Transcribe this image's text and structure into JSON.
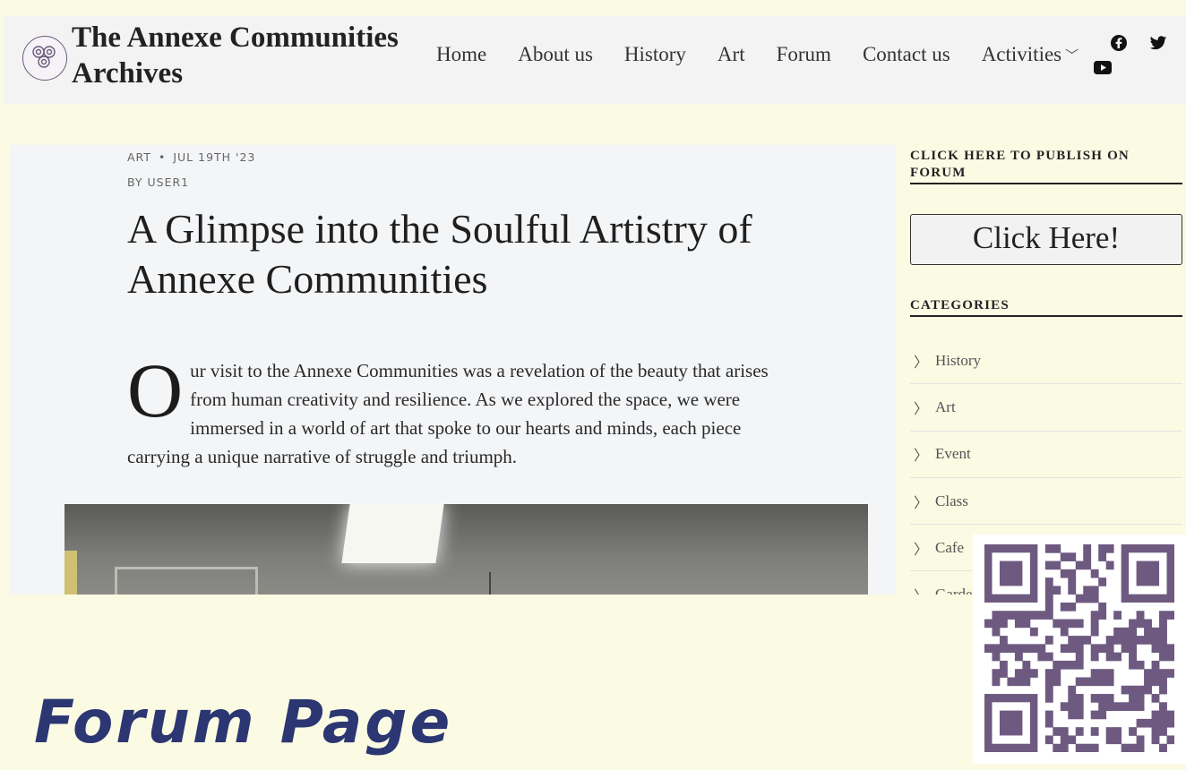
{
  "header": {
    "site_title": "The Annexe Communities Archives",
    "logo_icon": "triskele-spiral-logo",
    "nav": [
      "Home",
      "About us",
      "History",
      "Art",
      "Forum",
      "Contact us",
      "Activities"
    ],
    "social": [
      "facebook-icon",
      "twitter-icon",
      "youtube-icon"
    ]
  },
  "article": {
    "category": "ART",
    "date": "JUL 19TH '23",
    "author": "BY USER1",
    "title": "A Glimpse into the Soulful Artistry of Annexe Communities",
    "drop_cap": "O",
    "body": "ur visit to the Annexe Communities was a revelation of the beauty that arises from human creativity and resilience. As we explored the space, we were immersed in a world of art that spoke to our hearts and minds, each piece carrying a unique narrative of struggle and triumph."
  },
  "sidebar": {
    "publish_heading": "CLICK HERE TO PUBLISH ON FORUM",
    "publish_button": "Click Here!",
    "categories_heading": "CATEGORIES",
    "categories": [
      "History",
      "Art",
      "Event",
      "Class",
      "Cafe",
      "Garden"
    ]
  },
  "bottom": {
    "title": "Forum Page"
  },
  "colors": {
    "background": "#fbfae3",
    "title_blue": "#2b3672",
    "qr_purple": "#6e5a80"
  }
}
